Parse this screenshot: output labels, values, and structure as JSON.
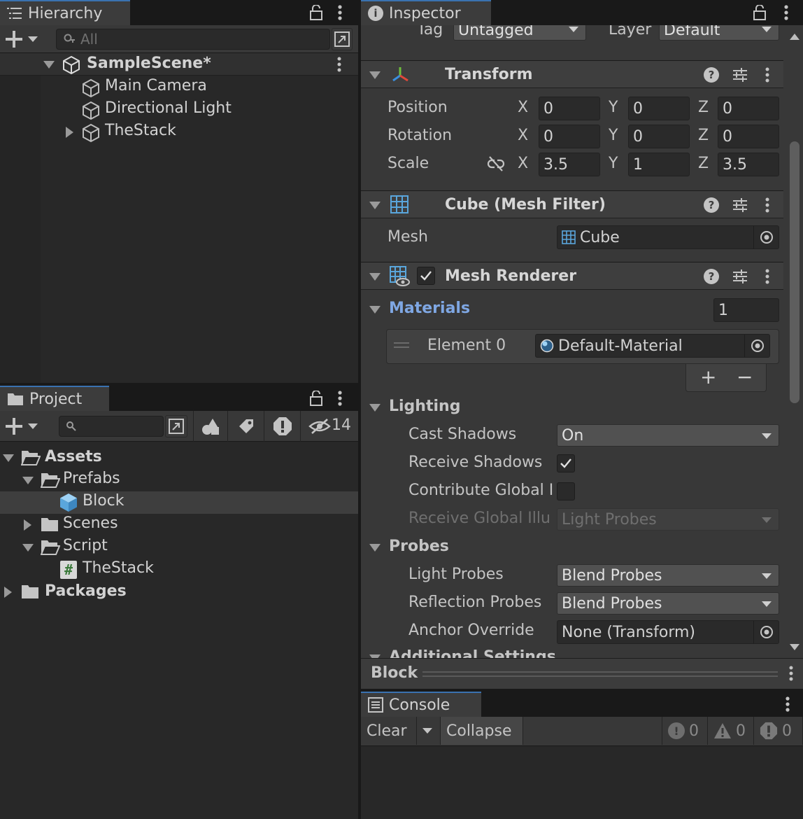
{
  "hierarchy": {
    "tab_label": "Hierarchy",
    "search_placeholder": "All",
    "scene_name": "SampleScene*",
    "items": [
      {
        "label": "Main Camera"
      },
      {
        "label": "Directional Light"
      },
      {
        "label": "TheStack"
      }
    ]
  },
  "project": {
    "tab_label": "Project",
    "hidden_count": "14",
    "tree": [
      {
        "label": "Assets"
      },
      {
        "label": "Prefabs"
      },
      {
        "label": "Block"
      },
      {
        "label": "Scenes"
      },
      {
        "label": "Script"
      },
      {
        "label": "TheStack"
      },
      {
        "label": "Packages"
      }
    ]
  },
  "inspector": {
    "tab_label": "Inspector",
    "tag_label": "Tag",
    "tag_value": "Untagged",
    "layer_label": "Layer",
    "layer_value": "Default",
    "transform": {
      "title": "Transform",
      "position_label": "Position",
      "rotation_label": "Rotation",
      "scale_label": "Scale",
      "axis_x": "X",
      "axis_y": "Y",
      "axis_z": "Z",
      "position": [
        "0",
        "0",
        "0"
      ],
      "rotation": [
        "0",
        "0",
        "0"
      ],
      "scale": [
        "3.5",
        "1",
        "3.5"
      ]
    },
    "mesh_filter": {
      "title": "Cube (Mesh Filter)",
      "mesh_label": "Mesh",
      "mesh_value": "Cube"
    },
    "mesh_renderer": {
      "title": "Mesh Renderer",
      "materials_label": "Materials",
      "materials_count": "1",
      "element0_label": "Element 0",
      "element0_value": "Default-Material",
      "add_symbol": "+",
      "remove_symbol": "−",
      "lighting_label": "Lighting",
      "cast_shadows_label": "Cast Shadows",
      "cast_shadows_value": "On",
      "receive_shadows_label": "Receive Shadows",
      "contribute_gi_label": "Contribute Global I",
      "receive_gi_label": "Receive Global Illu",
      "receive_gi_value": "Light Probes",
      "probes_label": "Probes",
      "light_probes_label": "Light Probes",
      "light_probes_value": "Blend Probes",
      "reflection_probes_label": "Reflection Probes",
      "reflection_probes_value": "Blend Probes",
      "anchor_override_label": "Anchor Override",
      "anchor_override_value": "None (Transform)",
      "additional_settings_label": "Additional Settings"
    },
    "preview_label": "Block"
  },
  "console": {
    "tab_label": "Console",
    "clear_label": "Clear",
    "collapse_label": "Collapse",
    "info_count": "0",
    "warning_count": "0",
    "error_count": "0"
  },
  "colors": {
    "accent": "#3a72b0",
    "link_blue": "#7fa7e3",
    "panel_bg": "#282828",
    "header_bg": "#3e3e3e"
  }
}
